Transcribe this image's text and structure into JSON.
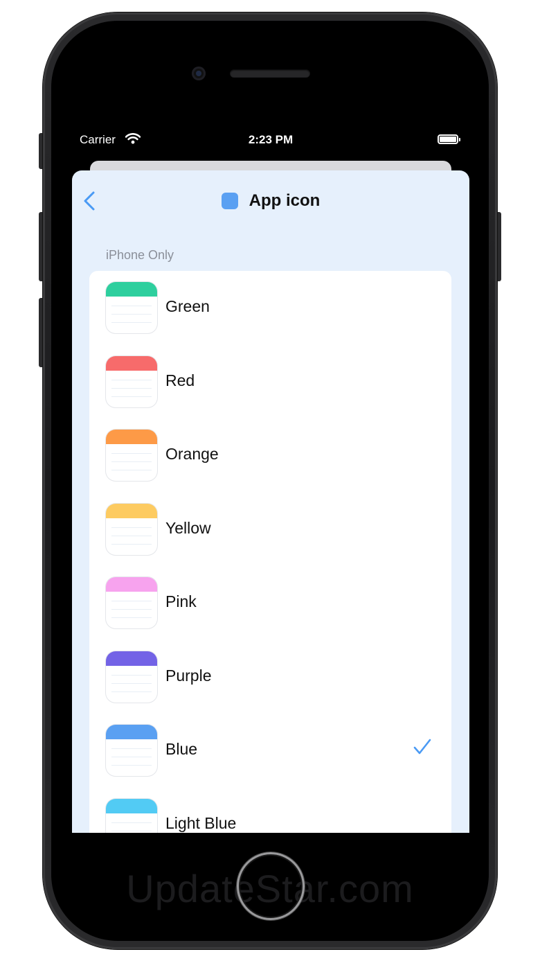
{
  "status_bar": {
    "carrier": "Carrier",
    "time": "2:23 PM"
  },
  "nav": {
    "title": "App icon",
    "title_icon_color": "#5aa0f2",
    "accent_color": "#4a9af4"
  },
  "section": {
    "header": "iPhone Only"
  },
  "icons": [
    {
      "label": "Green",
      "color": "#2ecf9e",
      "selected": false
    },
    {
      "label": "Red",
      "color": "#f76b6b",
      "selected": false
    },
    {
      "label": "Orange",
      "color": "#fd9a47",
      "selected": false
    },
    {
      "label": "Yellow",
      "color": "#fdcb61",
      "selected": false
    },
    {
      "label": "Pink",
      "color": "#f7a3ee",
      "selected": false
    },
    {
      "label": "Purple",
      "color": "#7363e6",
      "selected": false
    },
    {
      "label": "Blue",
      "color": "#5aa0f2",
      "selected": true
    },
    {
      "label": "Light Blue",
      "color": "#52cbf4",
      "selected": false
    }
  ],
  "watermark": "UpdateStar.com"
}
